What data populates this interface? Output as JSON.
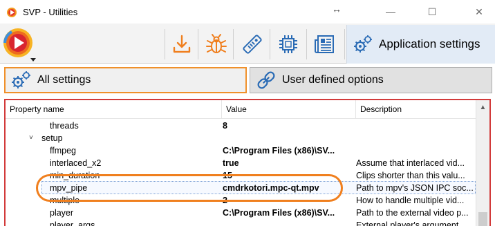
{
  "window": {
    "title": "SVP - Utilities",
    "resize_glyph": "↔",
    "minimize_glyph": "—",
    "maximize_glyph": "☐",
    "close_glyph": "✕"
  },
  "toolbar": {
    "logo_icon": "svp-logo-icon",
    "buttons": [
      {
        "icon": "download-icon"
      },
      {
        "icon": "bug-icon"
      },
      {
        "icon": "remote-control-icon"
      },
      {
        "icon": "cpu-chip-icon"
      },
      {
        "icon": "newspaper-icon"
      }
    ],
    "active_tab": {
      "icon": "gears-icon",
      "label": "Application settings"
    }
  },
  "modes": {
    "all_settings": "All settings",
    "user_defined": "User defined options"
  },
  "grid": {
    "headers": {
      "name": "Property name",
      "value": "Value",
      "description": "Description"
    },
    "rows": [
      {
        "name": "threads",
        "value": "8",
        "description": ""
      },
      {
        "name": "setup",
        "value": "",
        "description": "",
        "group": true,
        "expander": "˅"
      },
      {
        "name": "ffmpeg",
        "value": "C:\\Program Files (x86)\\SV...",
        "description": ""
      },
      {
        "name": "interlaced_x2",
        "value": "true",
        "description": "Assume that interlaced vid..."
      },
      {
        "name": "min_duration",
        "value": "15",
        "description": "Clips shorter than this valu..."
      },
      {
        "name": "mpv_pipe",
        "value": "cmdrkotori.mpc-qt.mpv",
        "description": "Path to mpv's JSON IPC soc...",
        "selected": true
      },
      {
        "name": "multiple",
        "value": "2",
        "description": "How to handle multiple vid..."
      },
      {
        "name": "player",
        "value": "C:\\Program Files (x86)\\SV...",
        "description": "Path to the external video p..."
      },
      {
        "name": "player_args",
        "value": "",
        "description": "External player's argument..."
      }
    ]
  },
  "colors": {
    "accent_orange": "#f07f1e",
    "grid_border": "#d23a3a",
    "active_tab_bg": "#e2ebf6"
  }
}
